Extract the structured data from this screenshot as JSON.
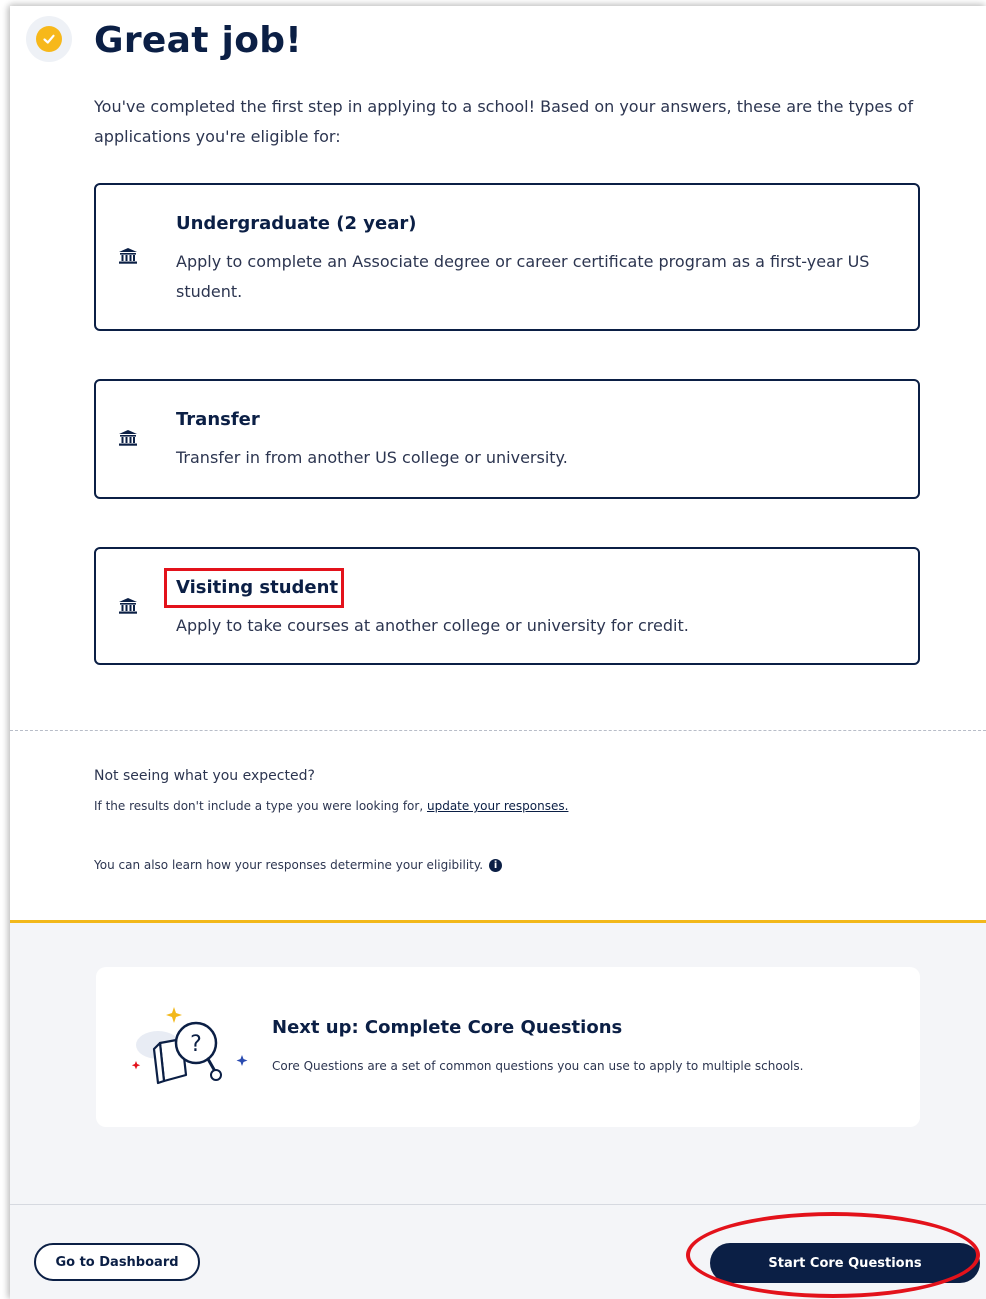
{
  "header": {
    "title": "Great job!",
    "intro": "You've completed the first step in applying to a school! Based on your answers, these are the types of applications you're eligible for:"
  },
  "cards": [
    {
      "title": "Undergraduate (2 year)",
      "description": "Apply to complete an Associate degree or career certificate program as a first-year US student.",
      "icon": "building-columns-icon"
    },
    {
      "title": "Transfer",
      "description": "Transfer in from another US college or university.",
      "icon": "building-columns-icon"
    },
    {
      "title": "Visiting student",
      "description": "Apply to take courses at another college or university for credit.",
      "icon": "building-columns-icon"
    }
  ],
  "help": {
    "question": "Not seeing what you expected?",
    "results_prefix": "If the results don't include a type you were looking for,",
    "update_link": "update your responses.",
    "learn_text": "You can also learn how your responses determine your eligibility."
  },
  "next_up": {
    "title": "Next up: Complete Core Questions",
    "description": "Core Questions are a set of common questions you can use to apply to multiple schools."
  },
  "footer": {
    "dashboard_button": "Go to Dashboard",
    "start_button": "Start Core Questions"
  },
  "colors": {
    "navy": "#0b1f45",
    "accent_yellow": "#f2b81b",
    "annotation_red": "#e3121b"
  }
}
